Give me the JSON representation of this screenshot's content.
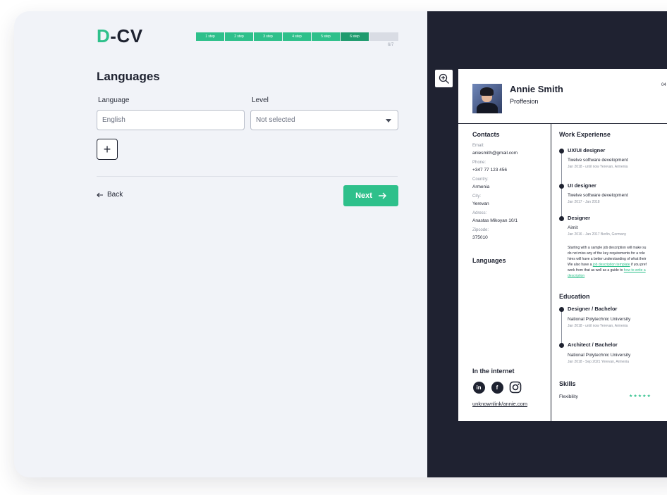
{
  "logo": {
    "d": "D",
    "rest": "-CV"
  },
  "progress": {
    "steps": [
      "1 step",
      "2 step",
      "3 step",
      "4 step",
      "5 step",
      "6 step"
    ],
    "counter": "6/7",
    "current": 6,
    "total": 7
  },
  "form": {
    "title": "Languages",
    "language_label": "Language",
    "level_label": "Level",
    "language_placeholder": "English",
    "level_value": "Not selected",
    "add_label": "+"
  },
  "nav": {
    "back": "Back",
    "next": "Next"
  },
  "colors": {
    "accent": "#2ec08b",
    "accent_dark": "#1f9b6e",
    "dark": "#1f2231",
    "panel": "#f1f3f8"
  },
  "preview": {
    "name": "Annie Smith",
    "profession": "Proffesion",
    "corner": "04",
    "contacts": {
      "title": "Contacts",
      "email_label": "Email:",
      "email": "aniesmith@gmail.com",
      "phone_label": "Phone:",
      "phone": "+347 77 123 456",
      "country_label": "Country:",
      "country": "Armenia",
      "city_label": "City:",
      "city": "Yerevan",
      "address_label": "Adress:",
      "address": "Anastas Mikoyan 10/1",
      "zip_label": "Zipcode:",
      "zip": "375010"
    },
    "languages_title": "Languages",
    "internet_title": "In the internet",
    "social": [
      "in",
      "f",
      "ig"
    ],
    "link": "unknownlink/annie.com",
    "work": {
      "title": "Work Experiense",
      "jobs": [
        {
          "title": "UX/UI designer",
          "company": "Twelve software development",
          "meta": "Jan 2018 - until now   Yerevan, Armenia"
        },
        {
          "title": "UI designer",
          "company": "Twelve software development",
          "meta": "Jan 2017 - Jan 2018"
        },
        {
          "title": "Designer",
          "company": "Aimit",
          "meta": "Jan 2016 - Jan 2017   Berlin, Germany"
        }
      ],
      "desc_1": "Starting with a sample job description will make su",
      "desc_2": "do not miss any of the key requirements for a role",
      "desc_3": "hires will have a better understanding of what their",
      "desc_4a": "We also have a ",
      "desc_4_link": "job description template",
      "desc_4b": " if you pref",
      "desc_5a": "work from that as well as a guide to ",
      "desc_5_link": "how to write a",
      "desc_6_link": "description"
    },
    "education": {
      "title": "Education",
      "items": [
        {
          "title": "Designer / Bachelor",
          "school": "National Polytechnic University",
          "meta": "Jan 2018 - until now   Yerevan, Armenia"
        },
        {
          "title": "Architect / Bachelor",
          "school": "National Polytechnic University",
          "meta": "Jan 2018 - Sep 2021   Yerevan, Armenia"
        }
      ]
    },
    "skills": {
      "title": "Skills",
      "items": [
        {
          "name": "Flexibility",
          "stars": "★★★★★"
        }
      ]
    }
  }
}
